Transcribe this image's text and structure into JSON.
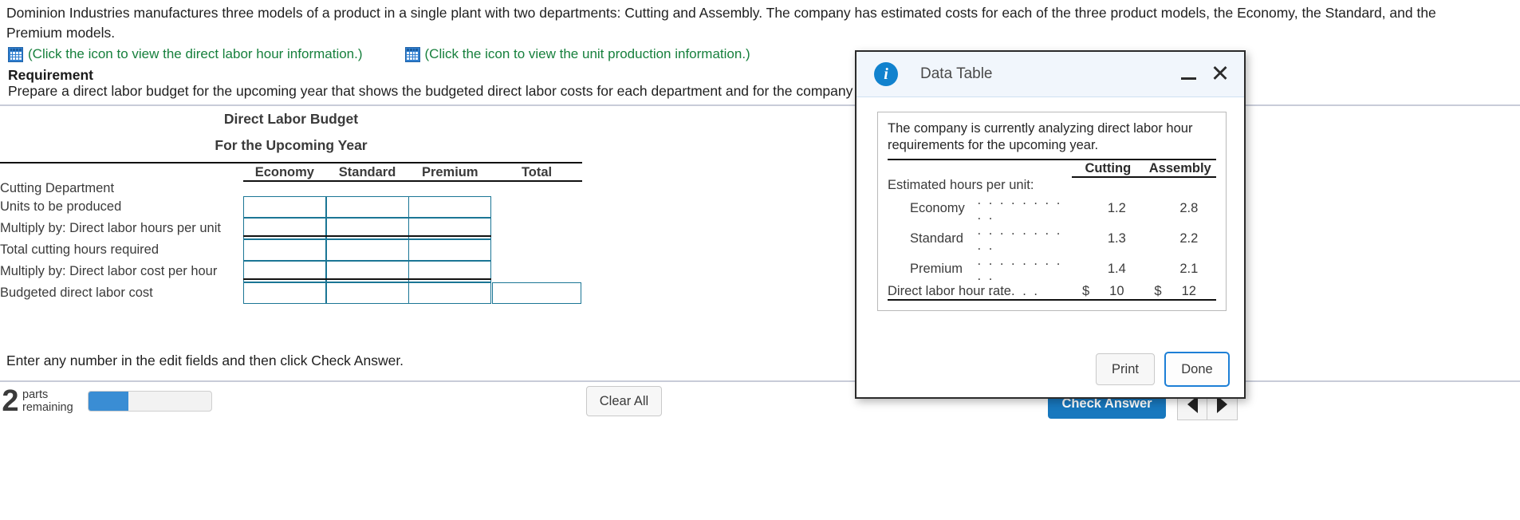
{
  "problem": {
    "statement": "Dominion Industries manufactures three models of a product in a single plant with two departments: Cutting and Assembly. The company has estimated costs for each of the three product models, the Economy, the Standard, and the Premium models."
  },
  "icon_links": [
    {
      "icon": "grid-table-icon",
      "text": "(Click the icon to view the direct labor hour information.)"
    },
    {
      "icon": "grid-table-icon",
      "text": "(Click the icon to view the unit production information.)"
    }
  ],
  "requirement": {
    "heading": "Requirement",
    "text": "Prepare a direct labor budget for the upcoming year that shows the budgeted direct labor costs for each department and for the company as a whole."
  },
  "worksheet": {
    "title": "Direct Labor Budget",
    "subtitle": "For the Upcoming Year",
    "columns": [
      "Economy",
      "Standard",
      "Premium",
      "Total"
    ],
    "section_label": "Cutting Department",
    "rows": [
      {
        "label": "Units to be produced",
        "inputs": 3,
        "total_input": false,
        "underline": false,
        "values": [
          "",
          "",
          ""
        ]
      },
      {
        "label": "Multiply by: Direct labor hours per unit",
        "inputs": 3,
        "total_input": false,
        "underline": true,
        "values": [
          "",
          "",
          ""
        ]
      },
      {
        "label": "Total cutting hours required",
        "inputs": 3,
        "total_input": false,
        "underline": false,
        "values": [
          "",
          "",
          ""
        ]
      },
      {
        "label": "Multiply by: Direct labor cost per hour",
        "inputs": 3,
        "total_input": false,
        "underline": true,
        "values": [
          "",
          "",
          ""
        ]
      },
      {
        "label": "Budgeted direct labor cost",
        "inputs": 3,
        "total_input": true,
        "underline": false,
        "values": [
          "",
          "",
          "",
          ""
        ]
      }
    ]
  },
  "footer": {
    "note": "Enter any number in the edit fields and then click Check Answer.",
    "parts_number": "2",
    "parts_line1": "parts",
    "parts_line2": "remaining",
    "progress_percent": 33,
    "clear_all_label": "Clear All",
    "check_answer_label": "Check Answer",
    "prev_icon": "triangle-left-icon",
    "next_icon": "triangle-right-icon"
  },
  "dialog": {
    "title": "Data Table",
    "info_icon": "info-circle-icon",
    "minimize_icon": "minimize-icon",
    "close_icon": "close-icon",
    "intro": "The company is currently analyzing direct labor hour requirements for the upcoming year.",
    "columns": [
      "Cutting",
      "Assembly"
    ],
    "section_label": "Estimated hours per unit:",
    "dots": ". . . . . . . . . .",
    "rows": [
      {
        "label": "Economy",
        "dots": ". . . . . . . . . .",
        "cutting": "1.2",
        "assembly": "2.8"
      },
      {
        "label": "Standard",
        "dots": ". . . . . . . . . .",
        "cutting": "1.3",
        "assembly": "2.2"
      },
      {
        "label": "Premium",
        "dots": ". . . . . . . . . .",
        "cutting": "1.4",
        "assembly": "2.1"
      }
    ],
    "rate_row": {
      "label": "Direct labor hour rate",
      "dots": ". . . . . .",
      "cutting_currency": "$",
      "cutting": "10",
      "assembly_currency": "$",
      "assembly": "12"
    },
    "print_label": "Print",
    "done_label": "Done"
  },
  "colors": {
    "link_green": "#17803d",
    "input_border": "#1b7695",
    "accent_blue": "#1878be",
    "dialog_header": "#f1f6fc",
    "info_blue": "#1182ce",
    "done_border": "#1d7fd6"
  }
}
